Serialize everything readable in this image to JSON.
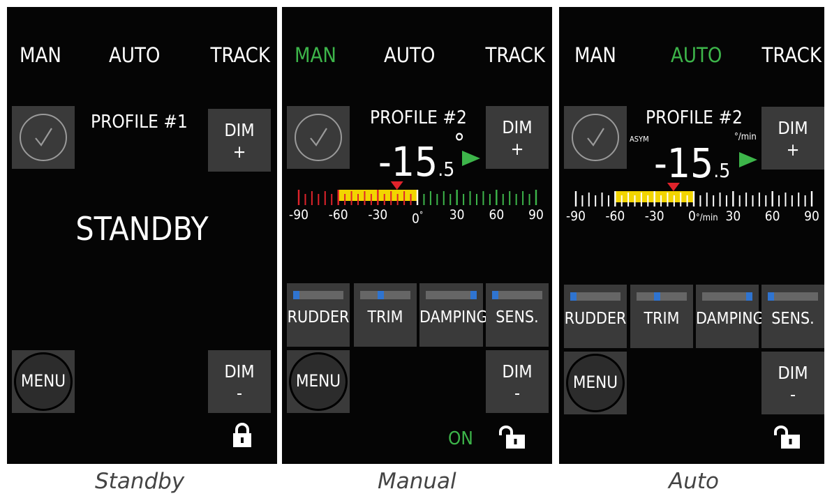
{
  "screens": [
    {
      "caption": "Standby",
      "modes": {
        "man": "MAN",
        "auto": "AUTO",
        "track": "TRACK",
        "active": "none"
      },
      "profile": "PROFILE #1",
      "status_text": "STANDBY",
      "dim_plus": {
        "line1": "DIM",
        "line2": "+"
      },
      "dim_minus": {
        "line1": "DIM",
        "line2": "-"
      },
      "menu_label": "MENU",
      "lock_state": "locked",
      "icons": {
        "confirm": "checkmark-icon",
        "lock": "padlock-locked-icon"
      }
    },
    {
      "caption": "Manual",
      "modes": {
        "man": "MAN",
        "auto": "AUTO",
        "track": "TRACK",
        "active": "MAN"
      },
      "profile": "PROFILE #2",
      "heading": {
        "sign_int": "-15",
        "decimal": ".5",
        "unit": "°"
      },
      "scale": {
        "labels": [
          "-90",
          "-60",
          "-30",
          "0",
          "30",
          "60",
          "90"
        ],
        "zero_unit": "°",
        "range": [
          -90,
          90
        ],
        "highlight_range": [
          -60,
          0
        ],
        "indicator_value": -15.5,
        "colors": {
          "negative_ticks": "#e0232b",
          "positive_ticks": "#3db54a",
          "highlight": "#f2d500",
          "indicator": "#e0232b"
        }
      },
      "controls": [
        {
          "label": "RUDDER",
          "level": 0.0
        },
        {
          "label": "TRIM",
          "level": 0.4
        },
        {
          "label": "DAMPING",
          "level": 1.0
        },
        {
          "label": "SENS.",
          "level": 0.0
        }
      ],
      "dim_plus": {
        "line1": "DIM",
        "line2": "+"
      },
      "dim_minus": {
        "line1": "DIM",
        "line2": "-"
      },
      "menu_label": "MENU",
      "status_text": "ON",
      "lock_state": "unlocked",
      "icons": {
        "confirm": "checkmark-icon",
        "direction": "arrow-right-icon",
        "lock": "padlock-unlocked-icon"
      }
    },
    {
      "caption": "Auto",
      "modes": {
        "man": "MAN",
        "auto": "AUTO",
        "track": "TRACK",
        "active": "AUTO"
      },
      "profile": "PROFILE #2",
      "asym_label": "ASYM",
      "heading": {
        "sign_int": "-15",
        "decimal": ".5",
        "unit": "°/min"
      },
      "scale": {
        "labels": [
          "-90",
          "-60",
          "-30",
          "0",
          "30",
          "60",
          "90"
        ],
        "zero_unit": "°/min",
        "range": [
          -90,
          90
        ],
        "highlight_range": [
          -60,
          0
        ],
        "indicator_value": -15.5,
        "colors": {
          "negative_ticks": "#ffffff",
          "positive_ticks": "#ffffff",
          "highlight": "#f2d500",
          "indicator": "#e0232b"
        }
      },
      "controls": [
        {
          "label": "RUDDER",
          "level": 0.0
        },
        {
          "label": "TRIM",
          "level": 0.4
        },
        {
          "label": "DAMPING",
          "level": 1.0
        },
        {
          "label": "SENS.",
          "level": 0.0
        }
      ],
      "dim_plus": {
        "line1": "DIM",
        "line2": "+"
      },
      "dim_minus": {
        "line1": "DIM",
        "line2": "-"
      },
      "menu_label": "MENU",
      "lock_state": "unlocked",
      "icons": {
        "confirm": "checkmark-icon",
        "direction": "arrow-right-icon",
        "lock": "padlock-unlocked-icon"
      }
    }
  ],
  "colors": {
    "active_mode": "#3db54a",
    "button_bg": "#3a3a3a",
    "screen_bg": "#050505"
  }
}
